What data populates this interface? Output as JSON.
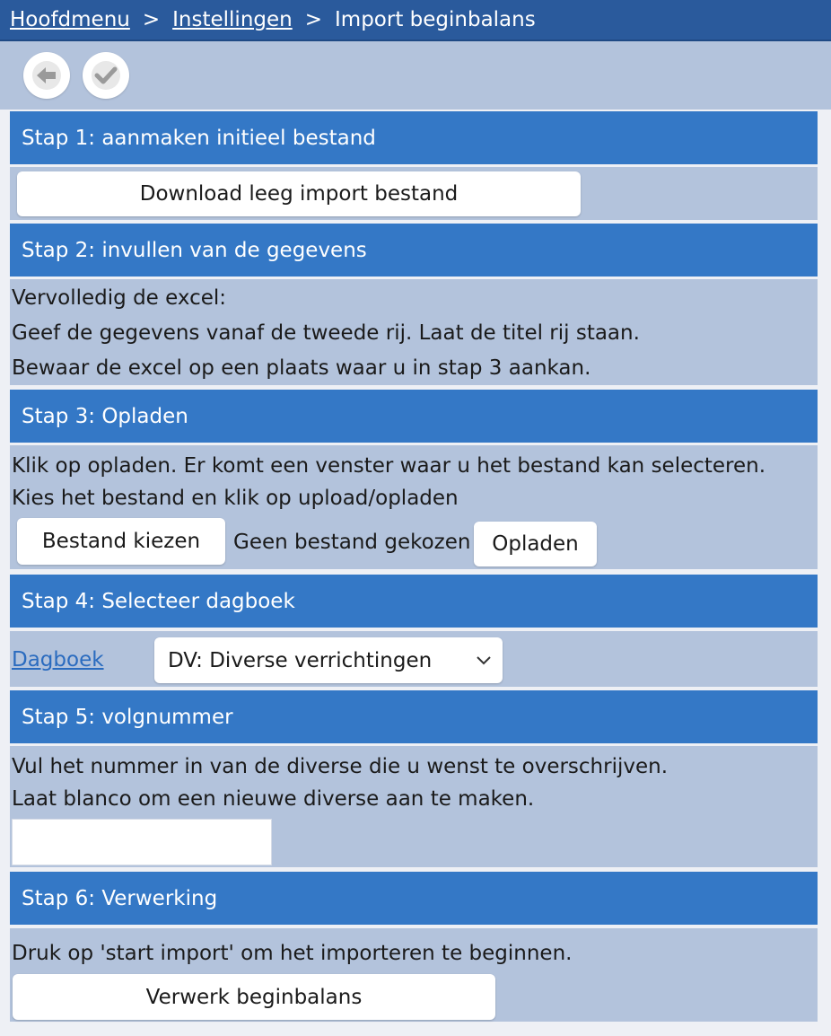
{
  "breadcrumb": {
    "home": "Hoofdmenu",
    "sep1": ">",
    "settings": "Instellingen",
    "sep2": ">",
    "current": "Import beginbalans"
  },
  "toolbar": {
    "back_icon": "arrow-left-icon",
    "confirm_icon": "checkmark-icon"
  },
  "steps": {
    "s1": {
      "title": "Stap 1: aanmaken initieel bestand",
      "button": "Download leeg import bestand"
    },
    "s2": {
      "title": "Stap 2: invullen van de gegevens",
      "lines": [
        "Vervolledig de excel:",
        "Geef de gegevens vanaf de tweede rij. Laat de titel rij staan.",
        "Bewaar de excel op een plaats waar u in stap 3 aankan."
      ]
    },
    "s3": {
      "title": "Stap 3: Opladen",
      "lines": [
        "Klik op opladen. Er komt een venster waar u het bestand kan selecteren.",
        "Kies het bestand en klik op upload/opladen"
      ],
      "choose_button": "Bestand kiezen",
      "no_file": "Geen bestand gekozen",
      "upload_button": "Opladen"
    },
    "s4": {
      "title": "Stap 4: Selecteer dagboek",
      "label": "Dagboek",
      "selected": "DV: Diverse verrichtingen"
    },
    "s5": {
      "title": "Stap 5: volgnummer",
      "lines": [
        "Vul het nummer in van de diverse die u wenst te overschrijven.",
        "Laat blanco om een nieuwe diverse aan te maken."
      ],
      "input_value": ""
    },
    "s6": {
      "title": "Stap 6: Verwerking",
      "lines": [
        "Druk op 'start import' om het importeren te beginnen."
      ],
      "button": "Verwerk beginbalans"
    }
  },
  "colors": {
    "topbar": "#2a5a9c",
    "section_header": "#3478c6",
    "section_body": "#b3c3dc",
    "link": "#2a6bbf"
  }
}
